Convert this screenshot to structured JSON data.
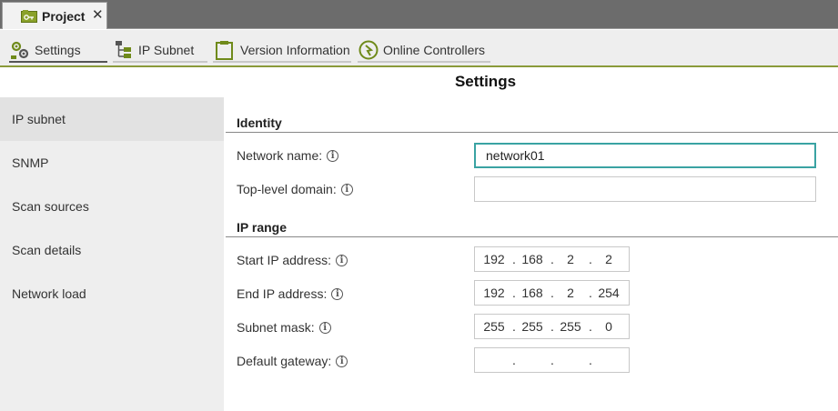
{
  "tabs": {
    "project_label": "Project",
    "close_glyph": "✕"
  },
  "toolbar": {
    "items": [
      {
        "label": "Settings",
        "icon": "settings-gears-icon",
        "active": true
      },
      {
        "label": "IP Subnet",
        "icon": "ip-subnet-icon",
        "active": false
      },
      {
        "label": "Version Information",
        "icon": "clipboard-icon",
        "active": false
      },
      {
        "label": "Online Controllers",
        "icon": "online-controllers-icon",
        "active": false
      }
    ],
    "accent_color": "#8a9a3a"
  },
  "page": {
    "title": "Settings"
  },
  "sidebar": {
    "items": [
      {
        "label": "IP subnet",
        "active": true
      },
      {
        "label": "SNMP",
        "active": false
      },
      {
        "label": "Scan sources",
        "active": false
      },
      {
        "label": "Scan details",
        "active": false
      },
      {
        "label": "Network load",
        "active": false
      }
    ]
  },
  "identity": {
    "title": "Identity",
    "network_name_label": "Network name:",
    "network_name_value": "network01",
    "tld_label": "Top-level domain:",
    "tld_value": ""
  },
  "ip_range": {
    "title": "IP range",
    "start_label": "Start IP address:",
    "start": [
      "192",
      "168",
      "2",
      "2"
    ],
    "end_label": "End IP address:",
    "end": [
      "192",
      "168",
      "2",
      "254"
    ],
    "mask_label": "Subnet mask:",
    "mask": [
      "255",
      "255",
      "255",
      "0"
    ],
    "gateway_label": "Default gateway:",
    "gateway": [
      "",
      "",
      "",
      ""
    ]
  },
  "info_glyph": "i",
  "focus_color": "#3aa3a3"
}
